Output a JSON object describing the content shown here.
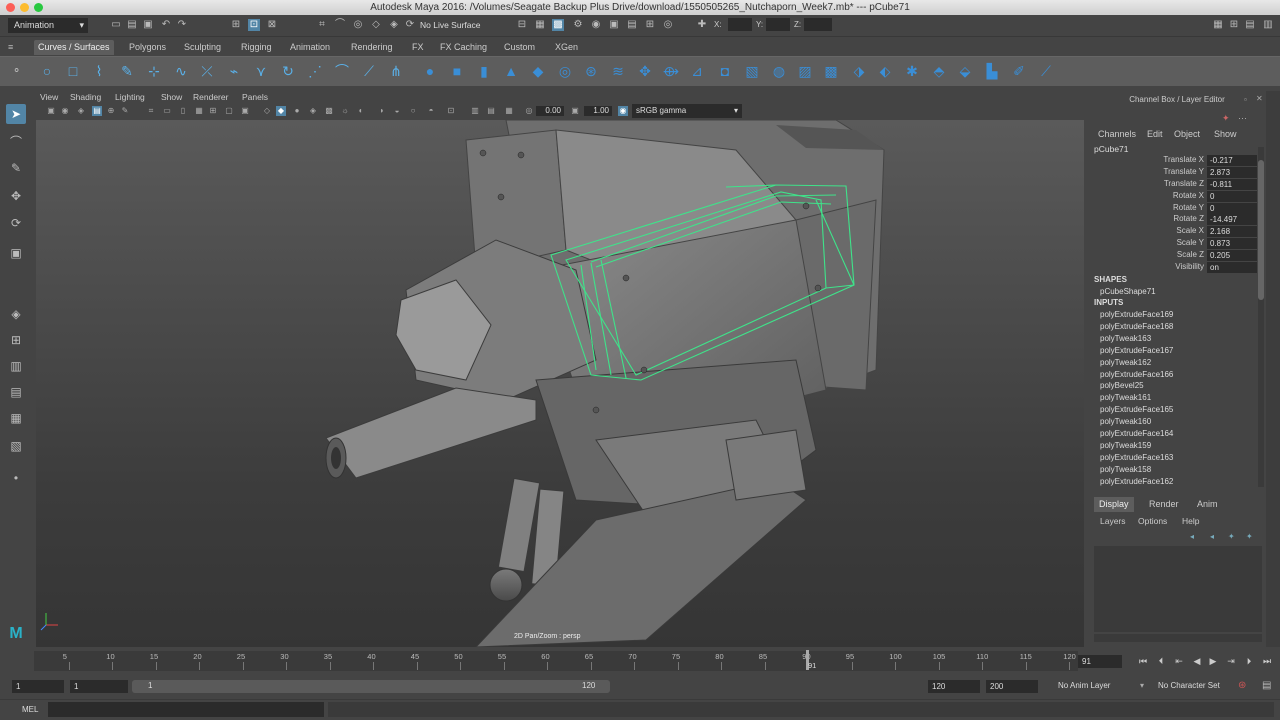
{
  "title_bar": {
    "text": "Autodesk Maya 2016: /Volumes/Seagate Backup Plus Drive/download/1550505265_Nutchaporn_Week7.mb*  ---  pCube71"
  },
  "status_line": {
    "menu_set": "Animation",
    "live_surface": "No Live Surface",
    "x_label": "X:",
    "y_label": "Y:",
    "z_label": "Z:"
  },
  "shelf_tabs": [
    "Curves / Surfaces",
    "Polygons",
    "Sculpting",
    "Rigging",
    "Animation",
    "Rendering",
    "FX",
    "FX Caching",
    "Custom",
    "XGen"
  ],
  "viewport": {
    "menus": [
      "View",
      "Shading",
      "Lighting",
      "Show",
      "Renderer",
      "Panels"
    ],
    "near_value": "0.00",
    "far_value": "1.00",
    "color_space": "sRGB gamma",
    "camera_label": "2D Pan/Zoom : persp"
  },
  "channel_box": {
    "title": "Channel Box / Layer Editor",
    "menus": [
      "Channels",
      "Edit",
      "Object",
      "Show"
    ],
    "object_name": "pCube71",
    "attributes": [
      {
        "label": "Translate X",
        "value": "-0.217"
      },
      {
        "label": "Translate Y",
        "value": "2.873"
      },
      {
        "label": "Translate Z",
        "value": "-0.811"
      },
      {
        "label": "Rotate X",
        "value": "0"
      },
      {
        "label": "Rotate Y",
        "value": "0"
      },
      {
        "label": "Rotate Z",
        "value": "-14.497"
      },
      {
        "label": "Scale X",
        "value": "2.168"
      },
      {
        "label": "Scale Y",
        "value": "0.873"
      },
      {
        "label": "Scale Z",
        "value": "0.205"
      },
      {
        "label": "Visibility",
        "value": "on"
      }
    ],
    "shapes_header": "SHAPES",
    "shape_name": "pCubeShape71",
    "inputs_header": "INPUTS",
    "inputs": [
      "polyExtrudeFace169",
      "polyExtrudeFace168",
      "polyTweak163",
      "polyExtrudeFace167",
      "polyTweak162",
      "polyExtrudeFace166",
      "polyBevel25",
      "polyTweak161",
      "polyExtrudeFace165",
      "polyTweak160",
      "polyExtrudeFace164",
      "polyTweak159",
      "polyExtrudeFace163",
      "polyTweak158",
      "polyExtrudeFace162"
    ]
  },
  "layer_editor": {
    "tabs": [
      "Display",
      "Render",
      "Anim"
    ],
    "menus": [
      "Layers",
      "Options",
      "Help"
    ]
  },
  "timeline": {
    "ticks": [
      "5",
      "10",
      "15",
      "20",
      "25",
      "30",
      "35",
      "40",
      "45",
      "50",
      "55",
      "60",
      "65",
      "70",
      "75",
      "80",
      "85",
      "90",
      "95",
      "100",
      "105",
      "110",
      "115",
      "120"
    ],
    "current_frame": "91",
    "current_frame_field": "91"
  },
  "range": {
    "start_field": "1",
    "anim_start": "1",
    "slider_start": "1",
    "slider_end": "120",
    "playback_end": "120",
    "anim_end": "200",
    "anim_layer": "No Anim Layer",
    "character_set": "No Character Set"
  },
  "command_line": {
    "language": "MEL"
  },
  "colors": {
    "selection_wire": "#3fe38a",
    "accent": "#5285a6",
    "panel": "#444444"
  }
}
